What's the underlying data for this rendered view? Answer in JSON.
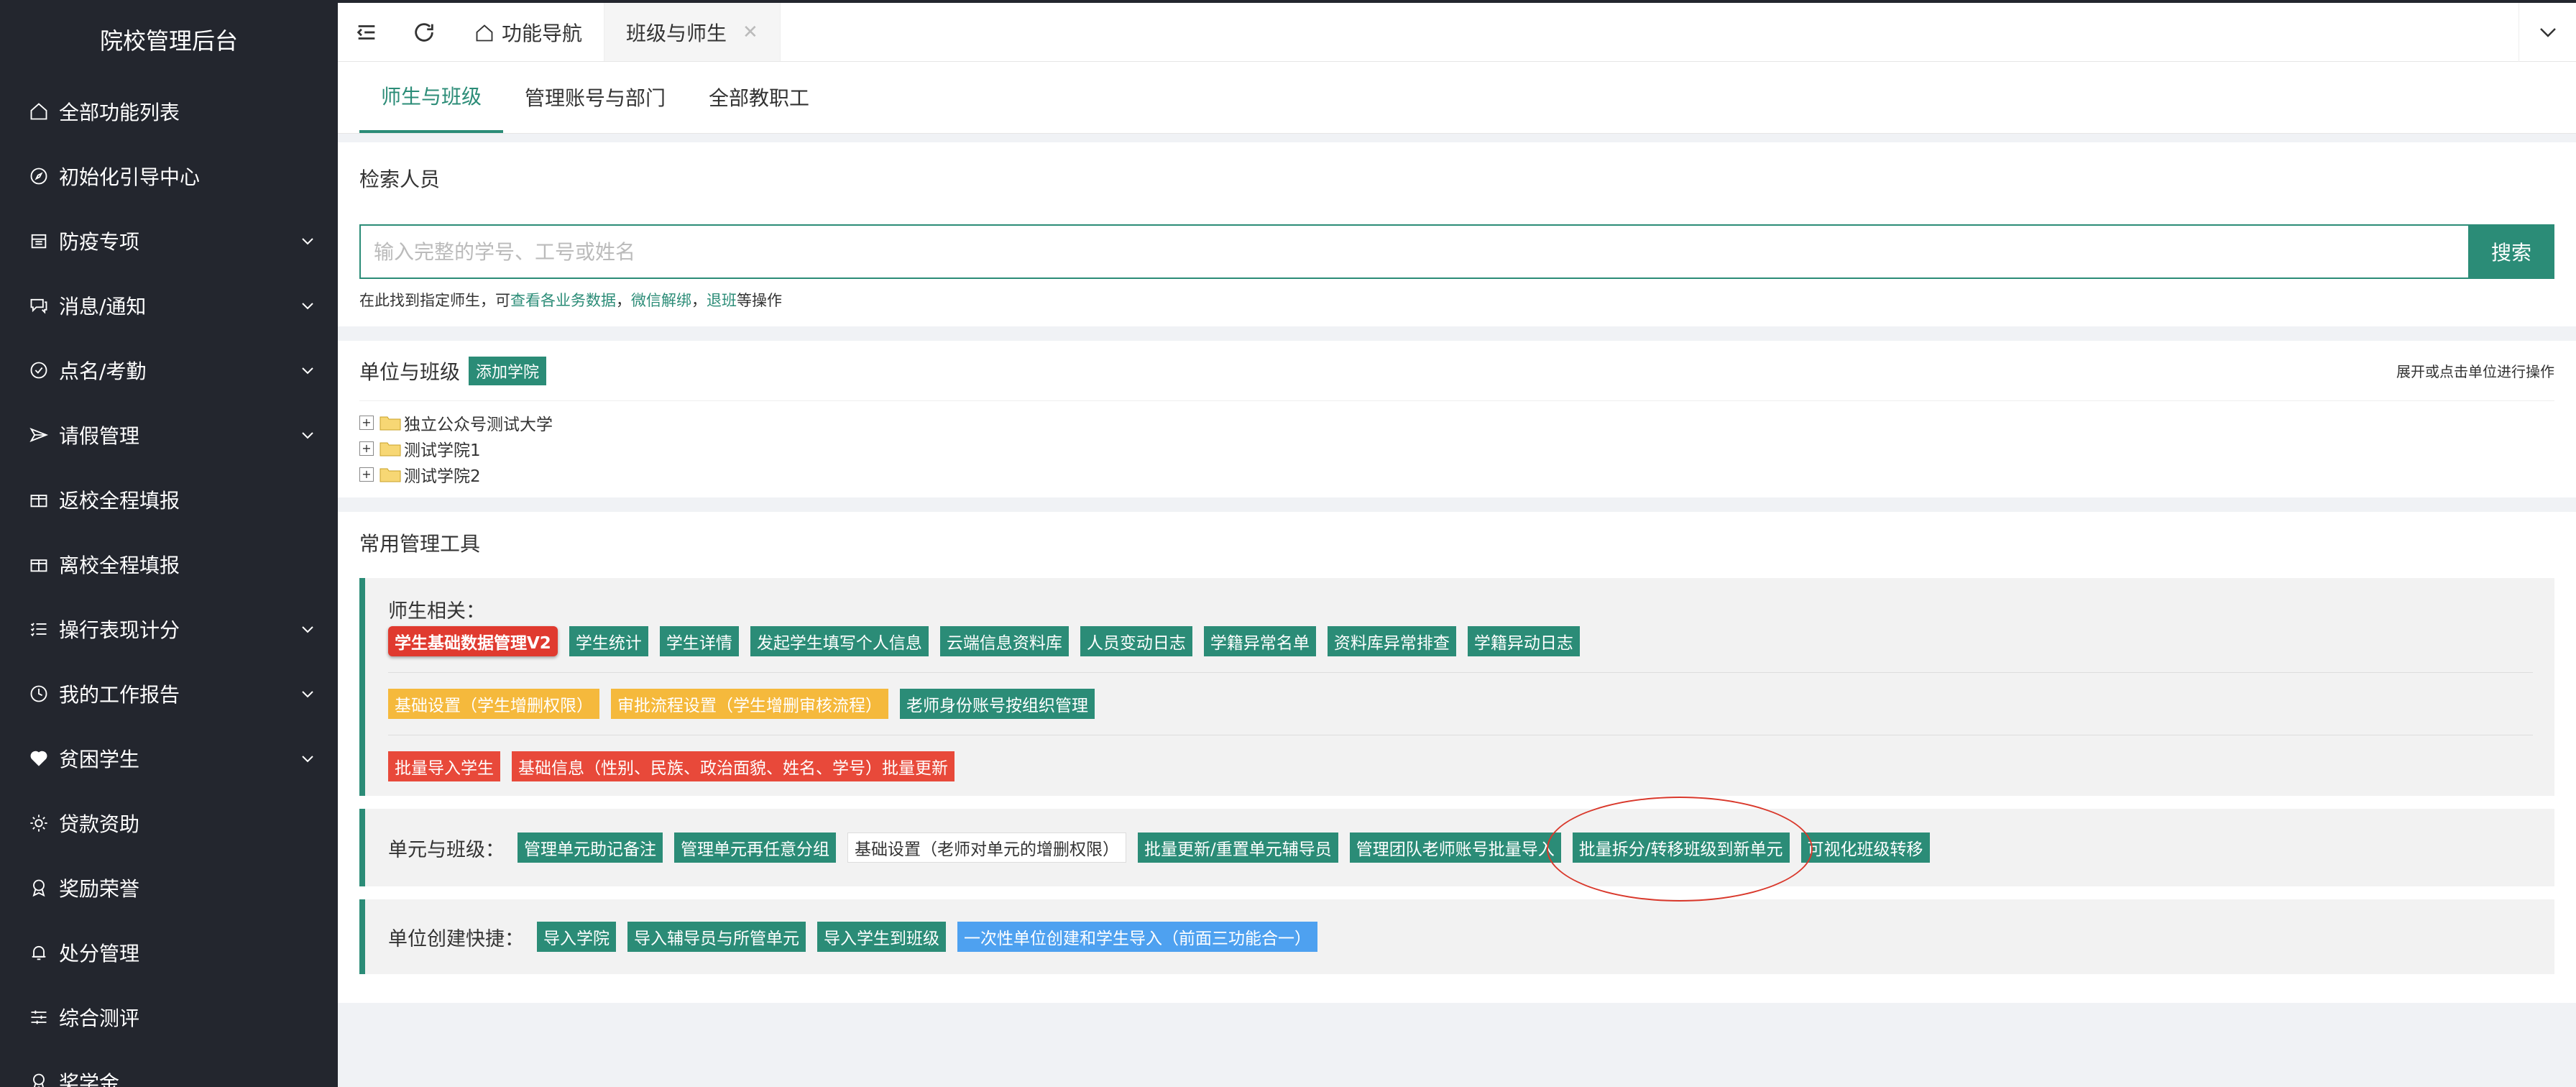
{
  "sidebar": {
    "title": "院校管理后台",
    "items": [
      {
        "label": "全部功能列表",
        "icon": "home-icon",
        "has_children": false
      },
      {
        "label": "初始化引导中心",
        "icon": "compass-icon",
        "has_children": false
      },
      {
        "label": "防疫专项",
        "icon": "calendar-icon",
        "has_children": true
      },
      {
        "label": "消息/通知",
        "icon": "chat-icon",
        "has_children": true
      },
      {
        "label": "点名/考勤",
        "icon": "check-circle-icon",
        "has_children": true
      },
      {
        "label": "请假管理",
        "icon": "send-icon",
        "has_children": true
      },
      {
        "label": "返校全程填报",
        "icon": "box-icon",
        "has_children": false
      },
      {
        "label": "离校全程填报",
        "icon": "box-icon",
        "has_children": false
      },
      {
        "label": "操行表现计分",
        "icon": "list-icon",
        "has_children": true
      },
      {
        "label": "我的工作报告",
        "icon": "clock-icon",
        "has_children": true
      },
      {
        "label": "贫困学生",
        "icon": "heart-icon",
        "has_children": true
      },
      {
        "label": "贷款资助",
        "icon": "sun-icon",
        "has_children": false
      },
      {
        "label": "奖励荣誉",
        "icon": "award-icon",
        "has_children": false
      },
      {
        "label": "处分管理",
        "icon": "bell-icon",
        "has_children": false
      },
      {
        "label": "综合测评",
        "icon": "sliders-icon",
        "has_children": false
      },
      {
        "label": "奖学金",
        "icon": "award-icon",
        "has_children": false
      }
    ]
  },
  "topbar": {
    "tabs": [
      {
        "label": "功能导航",
        "active": false
      },
      {
        "label": "班级与师生",
        "active": true
      }
    ]
  },
  "subtabs": [
    "师生与班级",
    "管理账号与部门",
    "全部教职工"
  ],
  "search": {
    "title": "检索人员",
    "placeholder": "输入完整的学号、工号或姓名",
    "value": "",
    "button": "搜索",
    "hint_prefix": "在此找到指定师生，可",
    "hint_link1": "查看各业务数据",
    "hint_sep": "，",
    "hint_link2": "微信解绑",
    "hint_link3": "退班",
    "hint_suffix": "等操作"
  },
  "units": {
    "title": "单位与班级",
    "add_button": "添加学院",
    "right_hint": "展开或点击单位进行操作",
    "tree": [
      "独立公众号测试大学",
      "测试学院1",
      "测试学院2"
    ]
  },
  "tools": {
    "title": "常用管理工具",
    "people_label": "师生相关：",
    "people_row1": [
      "学生基础数据管理V2",
      "学生统计",
      "学生详情",
      "发起学生填写个人信息",
      "云端信息资料库",
      "人员变动日志",
      "学籍异常名单",
      "资料库异常排查",
      "学籍异动日志"
    ],
    "people_row2": [
      "基础设置（学生增删权限）",
      "审批流程设置（学生增删审核流程）",
      "老师身份账号按组织管理"
    ],
    "people_row3": [
      "批量导入学生",
      "基础信息（性别、民族、政治面貌、姓名、学号）批量更新"
    ],
    "class_label": "单元与班级：",
    "class_buttons": [
      "管理单元助记备注",
      "管理单元再任意分组",
      "基础设置（老师对单元的增删权限）",
      "批量更新/重置单元辅导员",
      "管理团队老师账号批量导入",
      "批量拆分/转移班级到新单元",
      "可视化班级转移"
    ],
    "create_label": "单位创建快捷：",
    "create_buttons": [
      "导入学院",
      "导入辅导员与所管单元",
      "导入学生到班级",
      "一次性单位创建和学生导入（前面三功能合一）"
    ]
  },
  "colors": {
    "primary": "#2b8c77",
    "sidebar_bg": "#23262e",
    "danger": "#e8493a",
    "warning": "#f5b93c",
    "info": "#4ea1f0",
    "annotation": "#d9382b"
  }
}
